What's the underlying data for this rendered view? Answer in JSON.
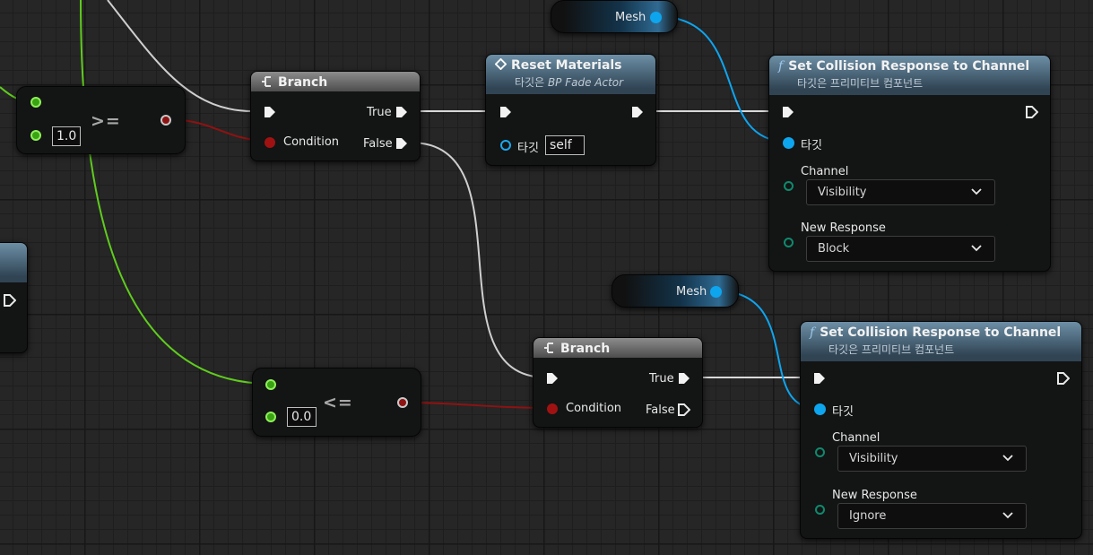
{
  "nodes": {
    "compare_ge": {
      "operator": ">=",
      "input_b_value": "1.0"
    },
    "compare_le": {
      "operator": "<=",
      "input_b_value": "0.0"
    },
    "branch_top": {
      "title": "Branch",
      "condition_label": "Condition",
      "true_label": "True",
      "false_label": "False"
    },
    "branch_bottom": {
      "title": "Branch",
      "condition_label": "Condition",
      "true_label": "True",
      "false_label": "False"
    },
    "reset_materials": {
      "title": "Reset Materials",
      "subtitle_prefix": "타깃은 ",
      "subtitle_target": "BP Fade Actor",
      "target_label": "타깃",
      "target_value": "self"
    },
    "mesh_top": {
      "label": "Mesh"
    },
    "mesh_bottom": {
      "label": "Mesh"
    },
    "set_collision_top": {
      "title": "Set Collision Response to Channel",
      "subtitle": "타깃은 프리미티브 컴포넌트",
      "target_label": "타깃",
      "channel_label": "Channel",
      "channel_value": "Visibility",
      "response_label": "New Response",
      "response_value": "Block"
    },
    "set_collision_bottom": {
      "title": "Set Collision Response to Channel",
      "subtitle": "타깃은 프리미티브 컴포넌트",
      "target_label": "타깃",
      "channel_label": "Channel",
      "channel_value": "Visibility",
      "response_label": "New Response",
      "response_value": "Ignore"
    }
  },
  "colors": {
    "exec_wire": "#d9d9d9",
    "float_wire": "#5fcc1e",
    "bool_wire": "#8f1212",
    "object_wire": "#0ea5ef",
    "function_header": "#304454",
    "branch_header": "#6b6b6b"
  },
  "icons": {
    "branch": "branch-icon",
    "event": "event-diamond-icon",
    "function": "function-icon",
    "dropdown": "chevron-down-icon"
  }
}
